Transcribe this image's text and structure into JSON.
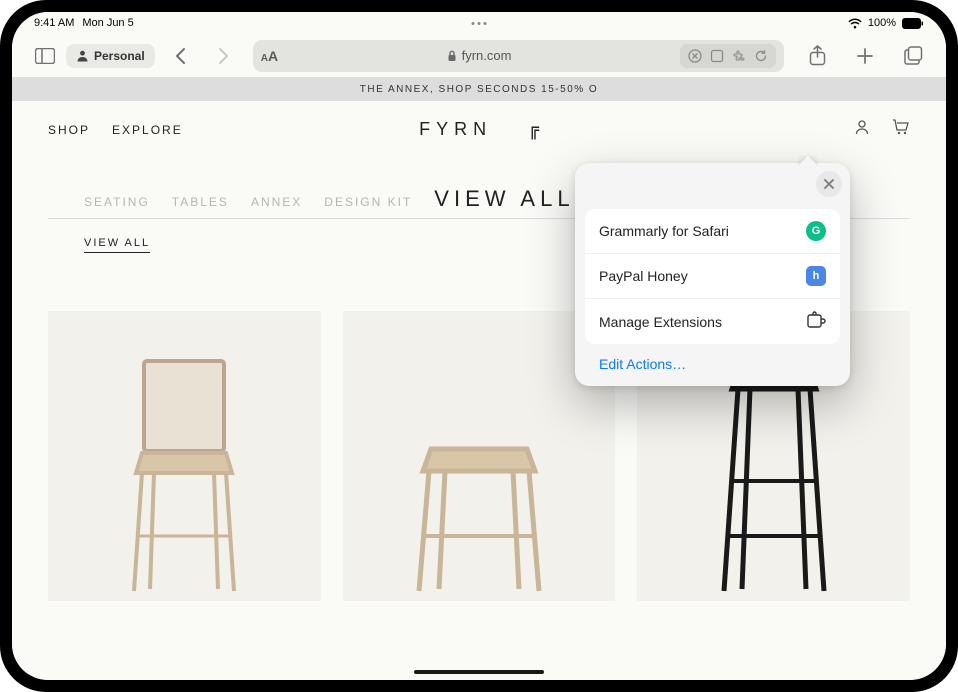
{
  "status": {
    "time": "9:41 AM",
    "date": "Mon Jun 5",
    "battery": "100%"
  },
  "toolbar": {
    "profile_label": "Personal",
    "address_text": "fyrn.com"
  },
  "site": {
    "banner": "THE ANNEX, SHOP SECONDS 15-50% O",
    "nav": {
      "shop": "SHOP",
      "explore": "EXPLORE"
    },
    "brand_name": "FYRN",
    "brand_mark": "╔",
    "categories": {
      "seating": "SEATING",
      "tables": "TABLES",
      "annex": "ANNEX",
      "design_kit": "DESIGN KIT",
      "view_all": "VIEW ALL"
    },
    "page_title": "VIEW ALL"
  },
  "popover": {
    "items": [
      {
        "label": "Grammarly for Safari",
        "badge": "G",
        "badge_kind": "grammarly"
      },
      {
        "label": "PayPal Honey",
        "badge": "h",
        "badge_kind": "honey"
      },
      {
        "label": "Manage Extensions",
        "badge_kind": "puzzle"
      }
    ],
    "edit_actions": "Edit Actions…"
  }
}
